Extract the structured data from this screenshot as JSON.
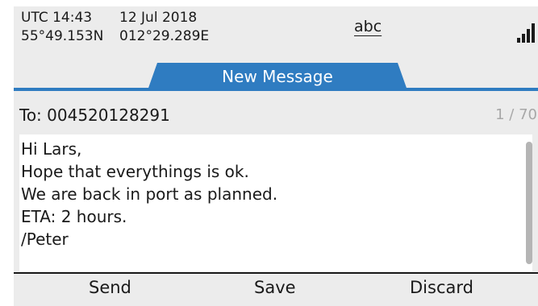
{
  "status_bar": {
    "time": "UTC 14:43",
    "date": "12 Jul 2018",
    "latitude": "55°49.153N",
    "longitude": "012°29.289E",
    "input_mode": "abc",
    "signal_icon": "signal-strength-icon"
  },
  "title": "New Message",
  "recipient": {
    "label": "To: 004520128291",
    "char_counter": "1 / 70"
  },
  "message": {
    "lines": [
      "Hi Lars,",
      "Hope that everythings is ok.",
      "We are back in port as planned.",
      "ETA: 2 hours.",
      "/Peter"
    ]
  },
  "softkeys": {
    "send": "Send",
    "save": "Save",
    "discard": "Discard"
  },
  "colors": {
    "accent": "#2f7cc1",
    "background": "#ececec",
    "text": "#1a1a1a",
    "muted": "#a7a7a7"
  }
}
